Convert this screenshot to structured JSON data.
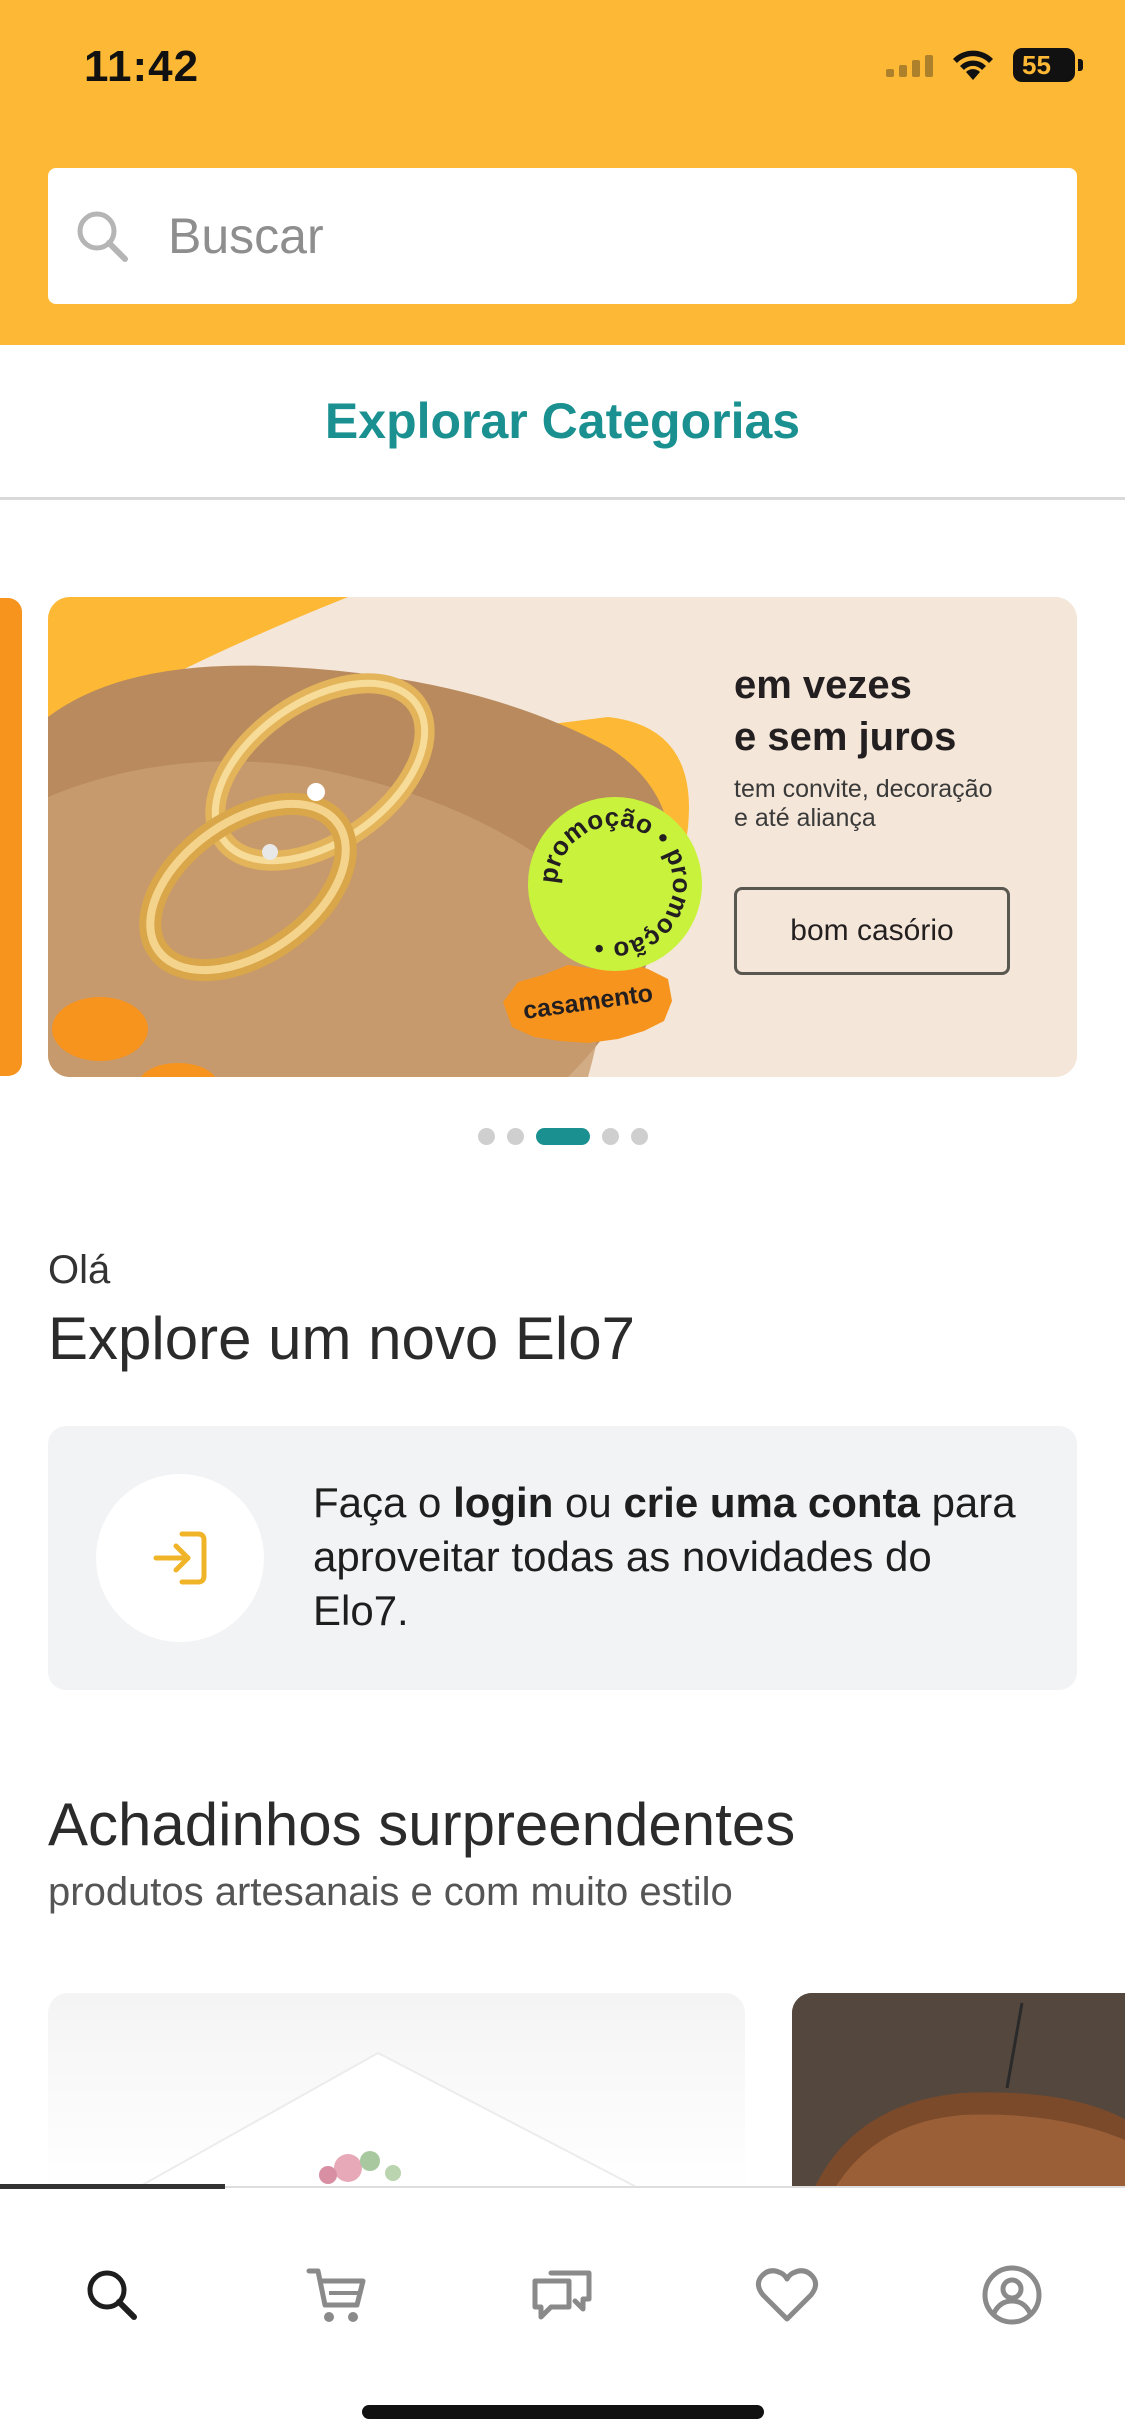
{
  "status_bar": {
    "time": "11:42",
    "battery": "55"
  },
  "search": {
    "placeholder": "Buscar"
  },
  "categories": {
    "label": "Explorar Categorias"
  },
  "banner": {
    "title_line1": "em vezes",
    "title_line2": "e sem juros",
    "subtitle_line1": "tem convite, decoração",
    "subtitle_line2": "e até aliança",
    "button_label": "bom casório",
    "promo_badge": "promoção • promoção •",
    "tag": "casamento",
    "dots_total": 5,
    "dots_active_index": 2
  },
  "greeting": {
    "small": "Olá",
    "title": "Explore um novo Elo7"
  },
  "login_card": {
    "text_prefix": "Faça o ",
    "login_link": "login",
    "text_middle": " ou ",
    "create_link": "crie uma conta",
    "text_suffix": " para aproveitar todas as novidades do Elo7."
  },
  "section": {
    "title": "Achadinhos surpreendentes",
    "subtitle": "produtos artesanais e com muito estilo"
  },
  "bottom_nav": {
    "items": [
      {
        "icon": "search-icon",
        "active": true
      },
      {
        "icon": "cart-icon",
        "active": false
      },
      {
        "icon": "chat-icon",
        "active": false
      },
      {
        "icon": "heart-icon",
        "active": false
      },
      {
        "icon": "profile-icon",
        "active": false
      }
    ]
  },
  "colors": {
    "header_yellow": "#fdb935",
    "accent_teal": "#1a9090",
    "banner_orange": "#f7941d",
    "promo_lime": "#c9f23d",
    "login_arrow": "#f0b429"
  }
}
